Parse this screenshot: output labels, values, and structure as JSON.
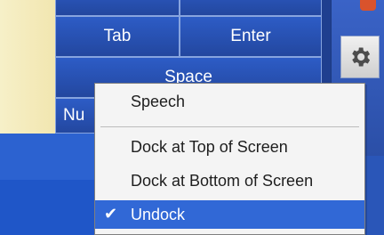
{
  "keyboard": {
    "keys": {
      "tab": "Tab",
      "enter": "Enter",
      "space": "Space",
      "num_partial": "Nu"
    }
  },
  "context_menu": {
    "items": [
      {
        "label": "Speech",
        "checked": false,
        "selected": false
      },
      {
        "label": "Dock at Top of Screen",
        "checked": false,
        "selected": false
      },
      {
        "label": "Dock at Bottom of Screen",
        "checked": false,
        "selected": false
      },
      {
        "label": "Undock",
        "checked": true,
        "selected": true
      }
    ]
  },
  "colors": {
    "keyboard_bg": "#1f3f8f",
    "key_text": "#ffffff",
    "menu_bg": "#f4f4f4",
    "highlight": "#3168d6"
  },
  "icons": {
    "settings": "gear-icon",
    "checkmark": "check-icon"
  }
}
